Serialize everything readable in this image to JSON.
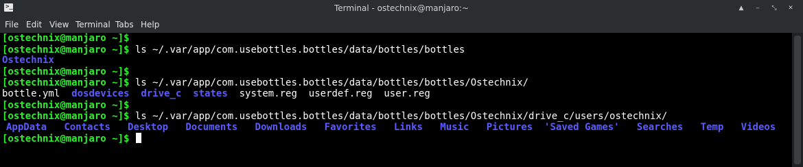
{
  "window": {
    "title": "Terminal - ostechnix@manjaro:~",
    "icon": "terminal-icon",
    "icon_glyph": ">_",
    "controls": {
      "keep_above_glyph": "▲",
      "minimize_glyph": "‒",
      "maximize_glyph": "⤡",
      "close_glyph": "✕"
    }
  },
  "menu": {
    "file": "File",
    "edit": "Edit",
    "view": "View",
    "terminal": "Terminal",
    "tabs": "Tabs",
    "help": "Help"
  },
  "colors": {
    "prompt": "#2bf02b",
    "directory": "#5b5bff",
    "text": "#fcfcfc",
    "background": "#000000"
  },
  "terminal": {
    "prompt": "[ostechnix@manjaro ~]$",
    "line1": {
      "cmd": ""
    },
    "line2": {
      "cmd": " ls ~/.var/app/com.usebottles.bottles/data/bottles/bottles"
    },
    "line3": {
      "dir": "Ostechnix"
    },
    "line4": {
      "cmd": ""
    },
    "line5": {
      "cmd": " ls ~/.var/app/com.usebottles.bottles/data/bottles/bottles/Ostechnix/"
    },
    "line6": {
      "f1": "bottle.yml",
      "d1": "dosdevices",
      "d2": "drive_c",
      "d3": "states",
      "f2": "system.reg",
      "f3": "userdef.reg",
      "f4": "user.reg"
    },
    "line7": {
      "cmd": ""
    },
    "line8": {
      "cmd": " ls ~/.var/app/com.usebottles.bottles/data/bottles/bottles/Ostechnix/drive_c/users/ostechnix/"
    },
    "line9": {
      "d1": "AppData",
      "d2": "Contacts",
      "d3": "Desktop",
      "d4": "Documents",
      "d5": "Downloads",
      "d6": "Favorites",
      "d7": "Links",
      "d8": "Music",
      "d9": "Pictures",
      "d10": "'Saved Games'",
      "d11": "Searches",
      "d12": "Temp",
      "d13": "Videos"
    },
    "line10": {
      "cmd": " "
    }
  }
}
